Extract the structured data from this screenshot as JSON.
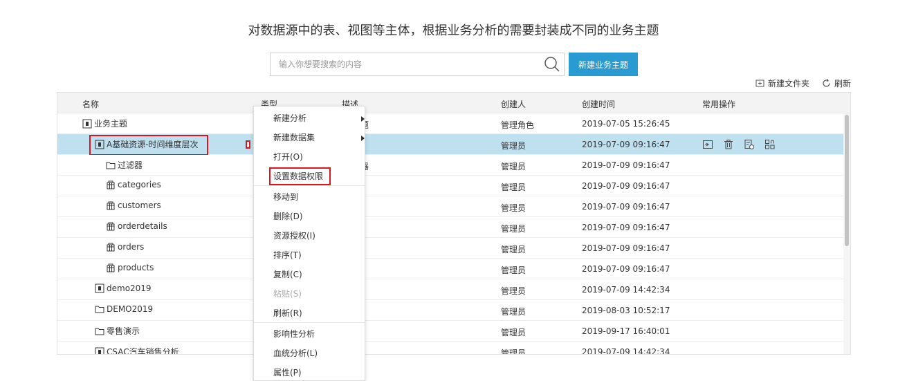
{
  "headline": "对数据源中的表、视图等主体，根据业务分析的需要封装成不同的业务主题",
  "search": {
    "placeholder": "输入你想要搜索的内容"
  },
  "new_topic_label": "新建业务主题",
  "top_actions": {
    "new_folder": "新建文件夹",
    "refresh": "刷新"
  },
  "columns": {
    "name": "名称",
    "type": "类型",
    "desc": "描述",
    "creator": "创建人",
    "created": "创建时间",
    "ops": "常用操作"
  },
  "rows": [
    {
      "name": "业务主题",
      "desc": "题",
      "creator": "管理角色",
      "created": "2019-07-05 15:26:45"
    },
    {
      "name": "A基础资源-时间维度层次",
      "desc": "",
      "creator": "管理员",
      "created": "2019-07-09 09:16:47"
    },
    {
      "name": "过滤器",
      "desc": "器",
      "creator": "管理员",
      "created": "2019-07-09 09:16:47"
    },
    {
      "name": "categories",
      "desc": "",
      "creator": "管理员",
      "created": "2019-07-09 09:16:47"
    },
    {
      "name": "customers",
      "desc": "",
      "creator": "管理员",
      "created": "2019-07-09 09:16:47"
    },
    {
      "name": "orderdetails",
      "desc": "",
      "creator": "管理员",
      "created": "2019-07-09 09:16:47"
    },
    {
      "name": "orders",
      "desc": "",
      "creator": "管理员",
      "created": "2019-07-09 09:16:47"
    },
    {
      "name": "products",
      "desc": "",
      "creator": "管理员",
      "created": "2019-07-09 09:16:47"
    },
    {
      "name": "demo2019",
      "desc": "",
      "creator": "管理员",
      "created": "2019-07-09 14:42:34"
    },
    {
      "name": "DEMO2019",
      "desc": "",
      "creator": "管理员",
      "created": "2019-08-03 10:52:17"
    },
    {
      "name": "零售演示",
      "desc": "",
      "creator": "管理员",
      "created": "2019-09-17 16:40:01"
    },
    {
      "name": "CSAC汽车销售分析",
      "desc": "",
      "creator": "管理员",
      "created": "2019-07-09 14:42:34"
    }
  ],
  "menu": [
    {
      "label": "新建分析"
    },
    {
      "label": "新建数据集"
    },
    {
      "label": "打开(O)"
    },
    {
      "label": "设置数据权限"
    },
    {
      "label": "移动到"
    },
    {
      "label": "删除(D)"
    },
    {
      "label": "资源授权(I)"
    },
    {
      "label": "排序(T)"
    },
    {
      "label": "复制(C)"
    },
    {
      "label": "粘贴(S)"
    },
    {
      "label": "刷新(R)"
    },
    {
      "label": "影响性分析"
    },
    {
      "label": "血统分析(L)"
    },
    {
      "label": "属性(P)"
    }
  ],
  "colors": {
    "primary": "#2a9ad2",
    "selected_row": "#bfe0ef",
    "highlight": "#e0141e"
  }
}
